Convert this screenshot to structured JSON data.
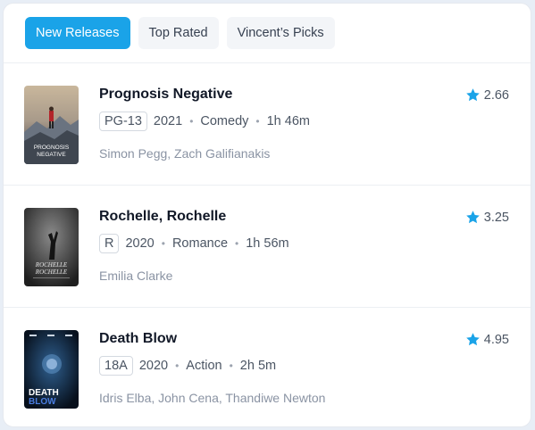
{
  "tabs": [
    {
      "label": "New Releases",
      "active": true
    },
    {
      "label": "Top Rated",
      "active": false
    },
    {
      "label": "Vincent’s Picks",
      "active": false
    }
  ],
  "movies": [
    {
      "title": "Prognosis Negative",
      "rating_code": "PG-13",
      "year": "2021",
      "genre": "Comedy",
      "runtime": "1h 46m",
      "cast": "Simon Pegg, Zach Galifianakis",
      "score": "2.66",
      "poster_text": [
        "PROGNOSIS",
        "NEGATIVE"
      ]
    },
    {
      "title": "Rochelle, Rochelle",
      "rating_code": "R",
      "year": "2020",
      "genre": "Romance",
      "runtime": "1h 56m",
      "cast": "Emilia Clarke",
      "score": "3.25",
      "poster_text": [
        "ROCHELLE",
        "ROCHELLE"
      ]
    },
    {
      "title": "Death Blow",
      "rating_code": "18A",
      "year": "2020",
      "genre": "Action",
      "runtime": "2h 5m",
      "cast": "Idris Elba, John Cena, Thandiwe Newton",
      "score": "4.95",
      "poster_text": [
        "DEATH",
        "BLOW"
      ]
    }
  ],
  "colors": {
    "accent": "#1aa3e8",
    "star": "#1aa3e8"
  },
  "icons": {
    "rating": "star-icon"
  }
}
